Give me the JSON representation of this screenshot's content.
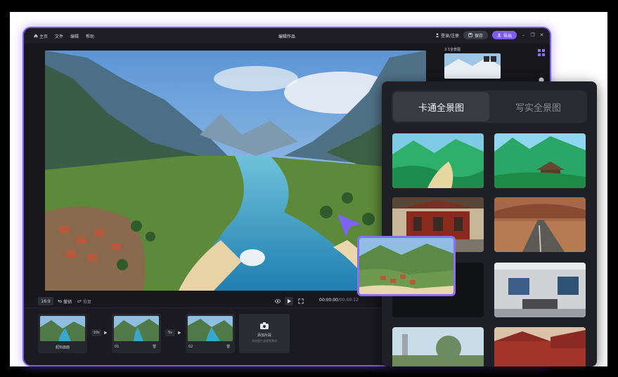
{
  "window": {
    "title": "编辑作品",
    "menu": [
      {
        "label": "主页",
        "icon": "home-icon"
      },
      {
        "label": "文件"
      },
      {
        "label": "编辑"
      },
      {
        "label": "帮助"
      }
    ],
    "login_label": "登录/注册",
    "save_label": "保存",
    "export_label": "导出"
  },
  "controls": {
    "ratio": "16:9",
    "undo_label": "撤销",
    "redo_label": "恢复",
    "time_current": "00:00:00",
    "time_total": "/00:00:12"
  },
  "timeline": {
    "clips": [
      {
        "label": "起始画面"
      },
      {
        "label": "01"
      },
      {
        "label": "02"
      }
    ],
    "transitions": [
      {
        "duration": "10s"
      },
      {
        "duration": "5s"
      }
    ],
    "add_clip_label": "添加片段",
    "add_clip_hint": "添加图片或视频素材"
  },
  "side_panel": {
    "title": "2:1全景图"
  },
  "overlay": {
    "tabs": [
      {
        "label": "卡通全景图",
        "active": true
      },
      {
        "label": "写实全景图",
        "active": false
      }
    ]
  },
  "colors": {
    "accent": "#7c5cf5",
    "background": "#17171c",
    "panel": "#1f2026"
  }
}
